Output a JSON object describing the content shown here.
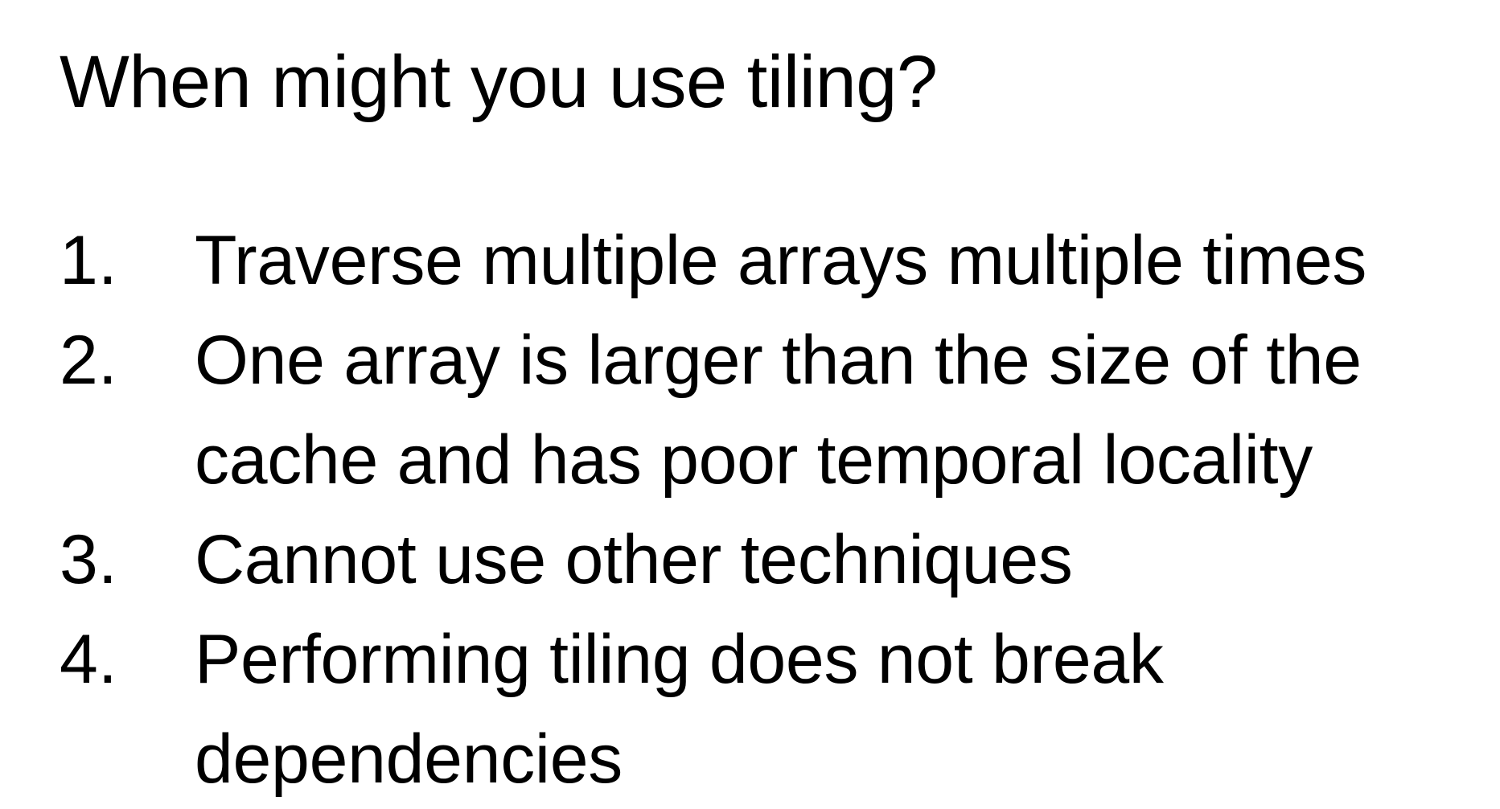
{
  "slide": {
    "title": "When might you use tiling?",
    "items": [
      {
        "number": "1.",
        "text": "Traverse multiple arrays multiple times"
      },
      {
        "number": "2.",
        "text": "One array is larger than the size of the cache and has poor temporal locality"
      },
      {
        "number": "3.",
        "text": "Cannot use other techniques"
      },
      {
        "number": "4.",
        "text": "Performing tiling does not break dependencies"
      }
    ]
  }
}
